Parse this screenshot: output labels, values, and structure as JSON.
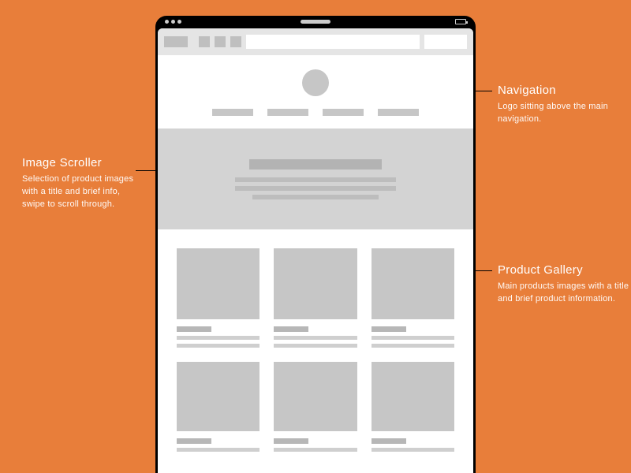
{
  "annotations": {
    "navigation": {
      "title": "Navigation",
      "desc": "Logo sitting above the main navigation."
    },
    "scroller": {
      "title": "Image Scroller",
      "desc": "Selection of product images with a title and brief info, swipe to scroll through."
    },
    "gallery": {
      "title": "Product Gallery",
      "desc": "Main products images with a title and brief product information."
    }
  }
}
